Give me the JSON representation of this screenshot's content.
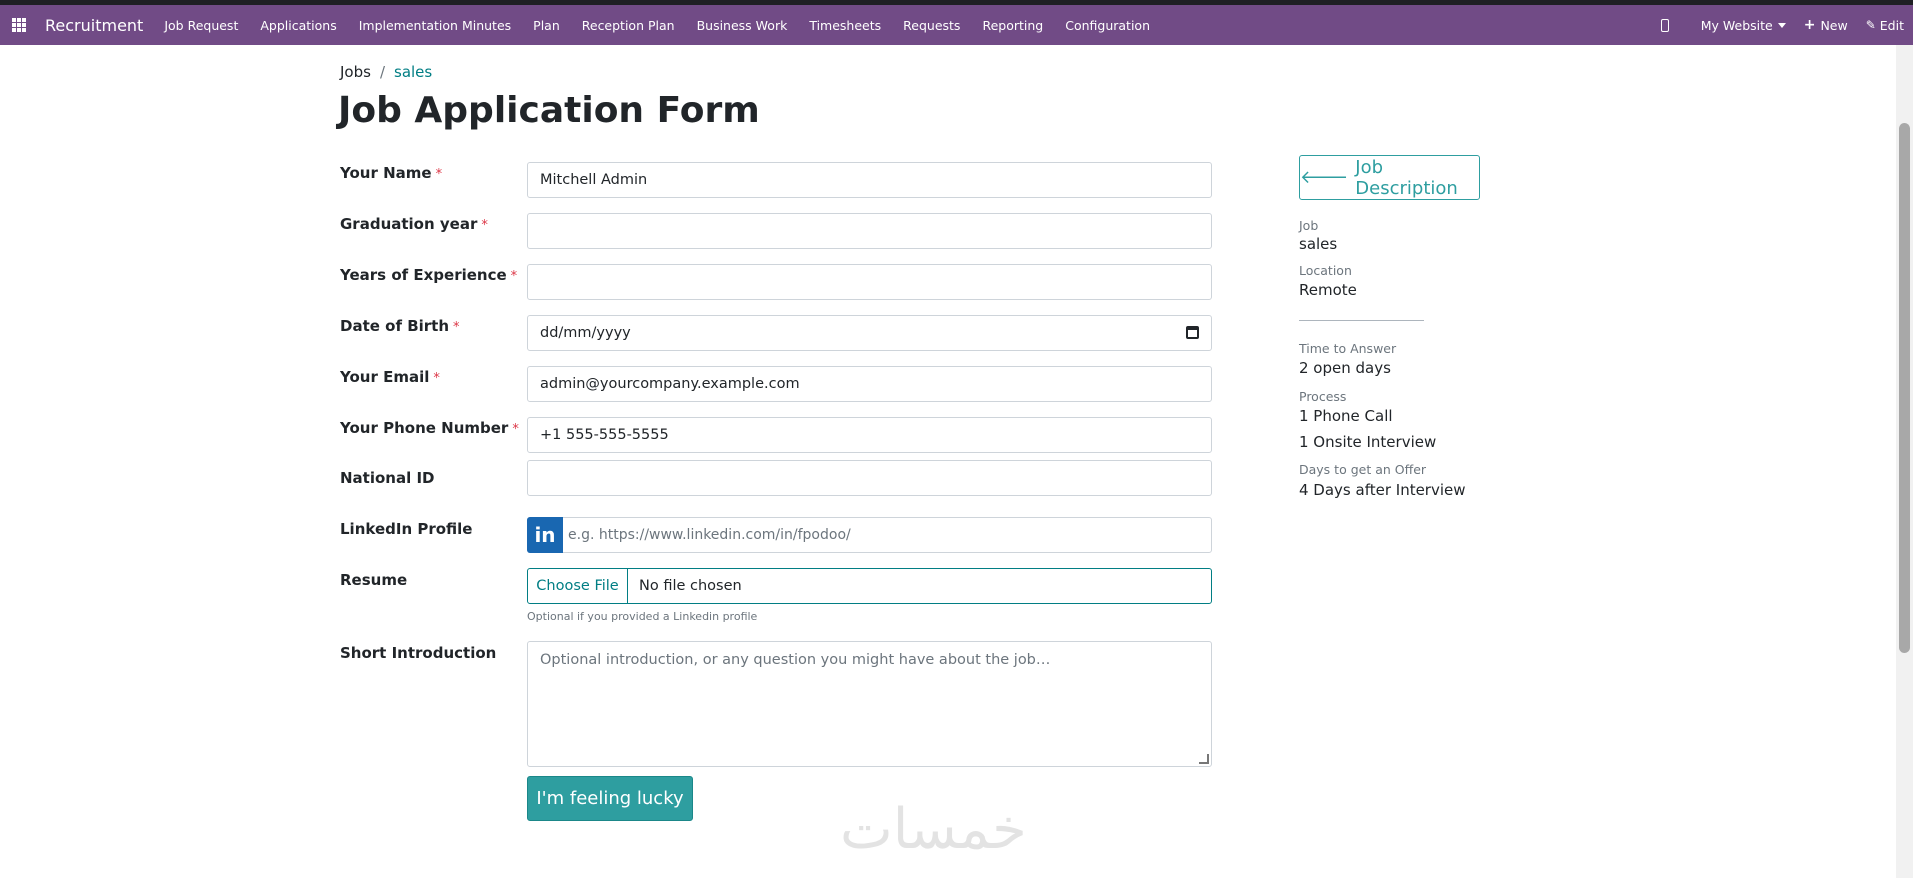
{
  "navbar": {
    "app_name": "Recruitment",
    "menu": [
      "Job Request",
      "Applications",
      "Implementation Minutes",
      "Plan",
      "Reception Plan",
      "Business Work",
      "Timesheets",
      "Requests",
      "Reporting",
      "Configuration"
    ],
    "website": "My Website",
    "new_label": "New",
    "edit_label": "Edit"
  },
  "breadcrumb": {
    "root": "Jobs",
    "separator": "/",
    "current": "sales"
  },
  "page_title": "Job Application Form",
  "form": {
    "required_mark": "*",
    "fields": {
      "name": {
        "label": "Your Name",
        "value": "Mitchell Admin"
      },
      "graduation": {
        "label": "Graduation year",
        "value": ""
      },
      "experience": {
        "label": "Years of Experience",
        "value": ""
      },
      "dob": {
        "label": "Date of Birth",
        "value": "dd/mm/yyyy"
      },
      "email": {
        "label": "Your Email",
        "value": "admin@yourcompany.example.com"
      },
      "phone": {
        "label": "Your Phone Number",
        "value": "+1 555-555-5555"
      },
      "national_id": {
        "label": "National ID",
        "value": ""
      },
      "linkedin": {
        "label": "LinkedIn Profile",
        "badge": "in",
        "placeholder": "e.g. https://www.linkedin.com/in/fpodoo/"
      },
      "resume": {
        "label": "Resume",
        "button": "Choose File",
        "status": "No file chosen",
        "hint": "Optional if you provided a Linkedin profile"
      },
      "intro": {
        "label": "Short Introduction",
        "placeholder": "Optional introduction, or any question you might have about the job…"
      }
    },
    "submit_label": "I'm feeling lucky"
  },
  "sidebar": {
    "job_description_button": "Job Description",
    "job_label": "Job",
    "job_value": "sales",
    "location_label": "Location",
    "location_value": "Remote",
    "time_label": "Time to Answer",
    "time_value": "2 open days",
    "process_label": "Process",
    "process_steps": [
      "1 Phone Call",
      "1 Onsite Interview"
    ],
    "offer_label": "Days to get an Offer",
    "offer_value": "4 Days after Interview"
  },
  "watermark": "خمسات",
  "colors": {
    "navbar": "#714b86",
    "accent": "#2e9ea0",
    "link": "#017e84",
    "required": "#dc3545"
  },
  "icons": [
    "apps-grid-icon",
    "mobile-phone-icon",
    "caret-down-icon",
    "plus-icon",
    "pencil-icon",
    "calendar-icon",
    "linkedin-icon",
    "arrow-left-icon"
  ]
}
